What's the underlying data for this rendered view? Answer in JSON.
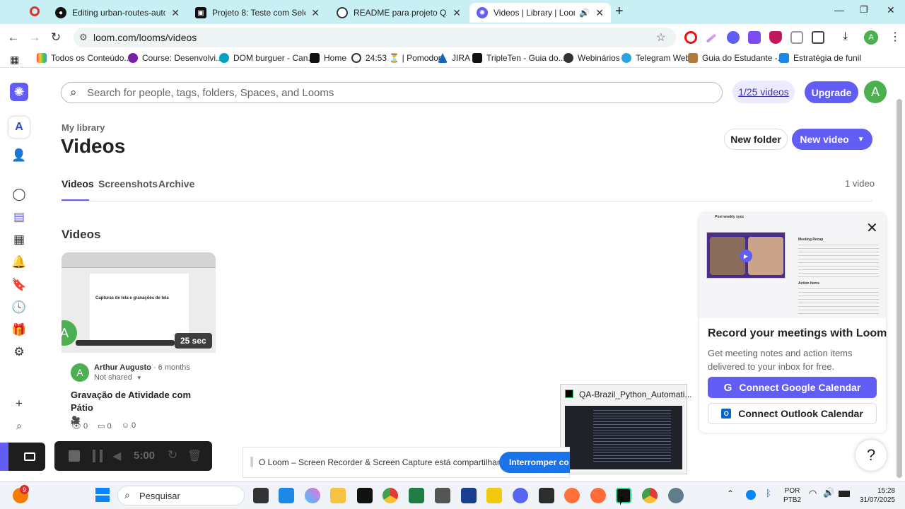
{
  "browser": {
    "tabs": [
      {
        "title": "Editing urban-routes-automatio",
        "icon": "github-icon"
      },
      {
        "title": "Projeto 8: Teste com Selenium",
        "icon": "tripleten-icon"
      },
      {
        "title": "README para projeto QA",
        "icon": "chatgpt-icon"
      },
      {
        "title": "Videos | Library | Loom",
        "icon": "loom-icon"
      }
    ],
    "new_tab": "+",
    "url": "loom.com/looms/videos",
    "bookmarks": [
      "Todos os Conteúdo...",
      "Course: Desenvolvi...",
      "DOM burguer - Can...",
      "Home",
      "24:53 ⏳ | Pomodor",
      "JIRA",
      "TripleTen - Guia do...",
      "Webinários",
      "Telegram Web",
      "Guia do Estudante -...",
      "Estratégia de funil"
    ]
  },
  "app": {
    "search_placeholder": "Search for people, tags, folders, Spaces, and Looms",
    "quota": "1/25 videos",
    "upgrade": "Upgrade",
    "avatar_letter": "A",
    "breadcrumb": "My library",
    "page_title": "Videos",
    "new_folder": "New folder",
    "new_video": "New video",
    "tabs": [
      "Videos",
      "Screenshots",
      "Archive"
    ],
    "video_count": "1 video",
    "section_title": "Videos",
    "card": {
      "duration": "25 sec",
      "author": "Arthur Augusto",
      "age": "6 months",
      "sharing": "Not shared",
      "title": "Gravação de Atividade com Pátio",
      "title_emoji": "🎥",
      "views": "0",
      "comments": "0",
      "reactions": "0",
      "thumb_heading": "Capturas de tela e gravações de tela"
    },
    "promo": {
      "heading": "Record your meetings with Loom",
      "body": "Get meeting notes and action items delivered to your inbox for free.",
      "google_btn": "Connect Google Calendar",
      "outlook_btn": "Connect Outlook Calendar",
      "mock_title": "Post weekly sync",
      "mock_section1": "Meeting Recap",
      "mock_section2": "Action Items"
    },
    "recorder_time": "5:00",
    "help": "?"
  },
  "share_notice": {
    "text": "O Loom – Screen Recorder & Screen Capture está compartilhando sua tela.",
    "stop_button": "Interromper co"
  },
  "task_preview": {
    "title": "QA-Brazil_Python_Automati..."
  },
  "taskbar": {
    "search": "Pesquisar",
    "notification_badge": "9",
    "lang": "POR",
    "layout": "PTB2",
    "time": "15:28",
    "date": "31/07/2025"
  },
  "colors": {
    "accent": "#625df5",
    "tabstrip": "#c8eff3",
    "avatar": "#4caf50"
  }
}
